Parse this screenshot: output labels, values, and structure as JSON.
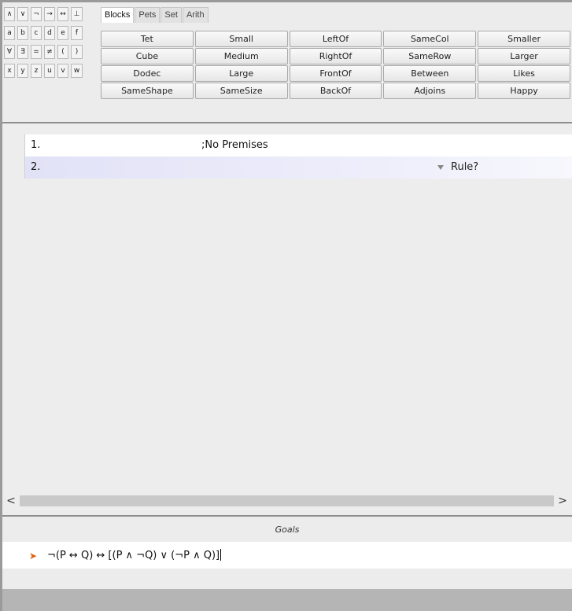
{
  "symbols": {
    "rows": [
      [
        "∧",
        "∨",
        "¬",
        "→",
        "↔",
        "⊥"
      ],
      [
        "a",
        "b",
        "c",
        "d",
        "e",
        "f"
      ],
      [
        "∀",
        "∃",
        "=",
        "≠",
        "(",
        ")"
      ],
      [
        "x",
        "y",
        "z",
        "u",
        "v",
        "w"
      ]
    ]
  },
  "tabs": [
    "Blocks",
    "Pets",
    "Set",
    "Arith"
  ],
  "active_tab": "Blocks",
  "predicates": [
    [
      "Tet",
      "Small",
      "LeftOf",
      "SameCol",
      "Smaller"
    ],
    [
      "Cube",
      "Medium",
      "RightOf",
      "SameRow",
      "Larger"
    ],
    [
      "Dodec",
      "Large",
      "FrontOf",
      "Between",
      "Likes"
    ],
    [
      "SameShape",
      "SameSize",
      "BackOf",
      "Adjoins",
      "Happy"
    ]
  ],
  "proof": {
    "lines": [
      {
        "num": "1.",
        "text": ";No Premises"
      },
      {
        "num": "2.",
        "text": "",
        "rule": "Rule?"
      }
    ]
  },
  "scroll": {
    "left": "<",
    "right": ">"
  },
  "goals": {
    "title": "Goals",
    "items": [
      {
        "formula": "¬(P ↔ Q) ↔ [(P ∧ ¬Q) ∨ (¬P ∧ Q)]"
      }
    ]
  }
}
